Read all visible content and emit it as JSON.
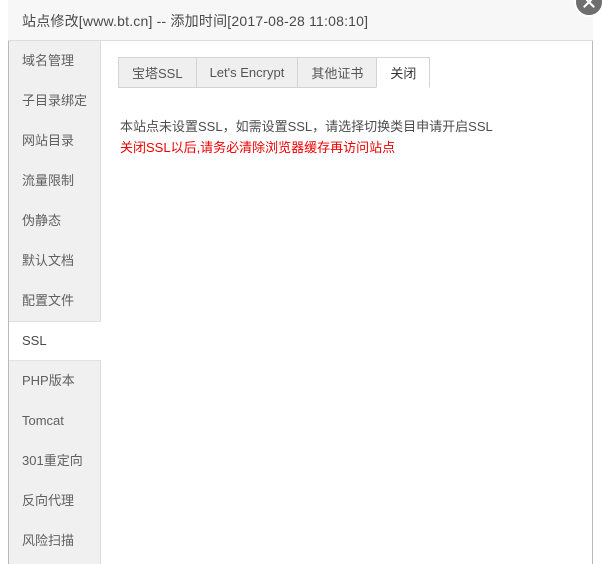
{
  "window": {
    "title": "站点修改[www.bt.cn] -- 添加时间[2017-08-28 11:08:10]",
    "close_icon": "close-icon"
  },
  "sidebar": {
    "items": [
      {
        "label": "域名管理",
        "active": false
      },
      {
        "label": "子目录绑定",
        "active": false
      },
      {
        "label": "网站目录",
        "active": false
      },
      {
        "label": "流量限制",
        "active": false
      },
      {
        "label": "伪静态",
        "active": false
      },
      {
        "label": "默认文档",
        "active": false
      },
      {
        "label": "配置文件",
        "active": false
      },
      {
        "label": "SSL",
        "active": true
      },
      {
        "label": "PHP版本",
        "active": false
      },
      {
        "label": "Tomcat",
        "active": false
      },
      {
        "label": "301重定向",
        "active": false
      },
      {
        "label": "反向代理",
        "active": false
      },
      {
        "label": "风险扫描",
        "active": false
      }
    ]
  },
  "main": {
    "tabs": [
      {
        "label": "宝塔SSL",
        "active": false
      },
      {
        "label": "Let's Encrypt",
        "active": false
      },
      {
        "label": "其他证书",
        "active": false
      },
      {
        "label": "关闭",
        "active": true
      }
    ],
    "content": {
      "info_text": "本站点未设置SSL，如需设置SSL，请选择切换类目申请开启SSL",
      "warning_text": "关闭SSL以后,请务必清除浏览器缓存再访问站点"
    }
  },
  "colors": {
    "warning": "#f00000",
    "titlebar_bg": "#f7f7f7",
    "sidebar_bg": "#f0f0f0",
    "tab_bg": "#efefef",
    "close_bg": "#6e6e6e"
  }
}
